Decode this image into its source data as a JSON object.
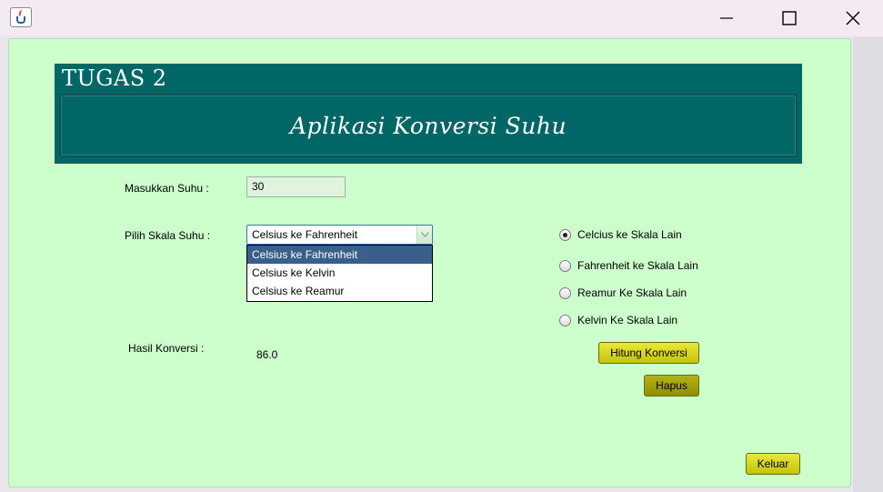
{
  "window": {
    "minimize_glyph": "—",
    "maximize_glyph": "☐",
    "close_glyph": "✕"
  },
  "header": {
    "title": "TUGAS 2",
    "subtitle": "Aplikasi Konversi Suhu"
  },
  "form": {
    "input_label": "Masukkan Suhu  :",
    "input_value": "30",
    "scale_label": "Pilih Skala Suhu :",
    "scale_selected": "Celsius ke Fahrenheit",
    "scale_options": [
      "Celsius ke Fahrenheit",
      "Celsius ke Kelvin",
      "Celsius ke Reamur"
    ],
    "result_label": "Hasil Konversi   :",
    "result_value": "86.0"
  },
  "radios": [
    {
      "label": "Celcius ke Skala Lain",
      "checked": true
    },
    {
      "label": "Fahrenheit ke Skala Lain",
      "checked": false
    },
    {
      "label": "Reamur Ke Skala Lain",
      "checked": false
    },
    {
      "label": "Kelvin Ke Skala Lain",
      "checked": false
    }
  ],
  "buttons": {
    "hitung": "Hitung Konversi",
    "hapus": "Hapus",
    "keluar": "Keluar"
  },
  "colors": {
    "panel_bg": "#ccffcc",
    "header_bg": "#006666",
    "button_yellow": "#d4d41e",
    "button_olive": "#9e9e0a",
    "selection": "#3a5f8a"
  }
}
